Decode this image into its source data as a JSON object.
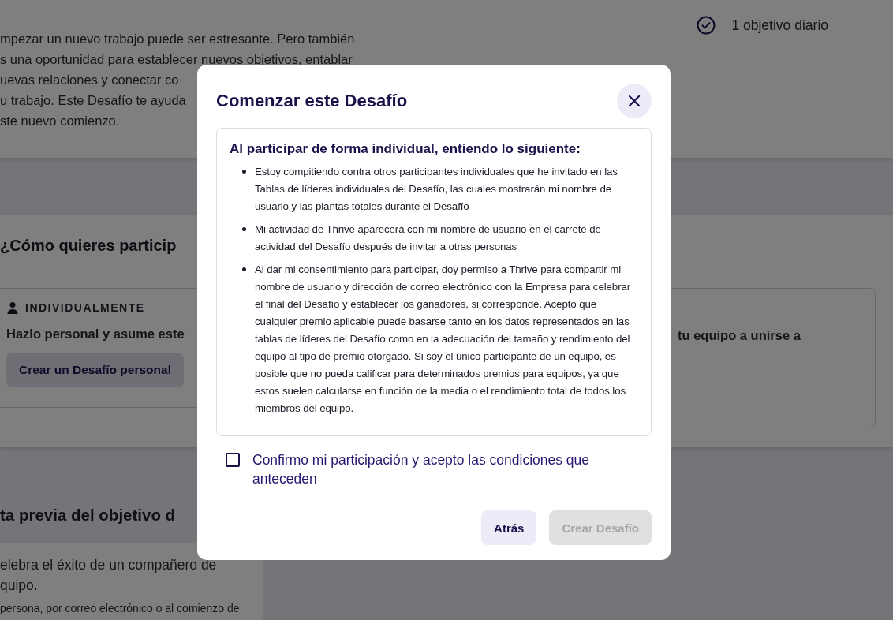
{
  "page": {
    "intro_lines": [
      "mpezar un nuevo trabajo puede ser estresante. Pero también",
      "s una oportunidad para establecer nuevos objetivos, entablar",
      "uevas relaciones y conectar co",
      "u trabajo. Este Desafío te ayuda",
      "ste nuevo comienzo."
    ],
    "daily_goal": {
      "label": "1 objetivo diario"
    },
    "participation": {
      "heading": "¿Cómo quieres particip",
      "individual": {
        "label": "INDIVIDUALMENTE",
        "description": "Hazlo personal y asume este",
        "button": "Crear un Desafío personal"
      },
      "team": {
        "description": "tu equipo a unirse a"
      }
    },
    "preview": {
      "heading": "ta previa del objetivo d",
      "lines": [
        "elebra el éxito de un compañero de",
        "quipo."
      ],
      "note": "persona, por correo electrónico o al comienzo de"
    }
  },
  "dialog": {
    "title": "Comenzar este Desafío",
    "terms": {
      "heading": "Al participar de forma individual, entiendo lo siguiente:",
      "items": [
        "Estoy compitiendo contra otros participantes individuales que he invitado en las Tablas de líderes individuales del Desafío, las cuales mostrarán mi nombre de usuario y las plantas totales durante el Desafío",
        "Mi actividad de Thrive aparecerá con mi nombre de usuario en el carrete de actividad del Desafío después de invitar a otras personas",
        "Al dar mi consentimiento para participar, doy permiso a Thrive para compartir mi nombre de usuario y dirección de correo electrónico con la Empresa para celebrar el final del Desafío y establecer los ganadores, si corresponde. Acepto que cualquier premio aplicable puede basarse tanto en los datos representados en las tablas de líderes del Desafío como en la adecuación del tamaño y rendimiento del equipo al tipo de premio otorgado. Si soy el único participante de un equipo, es posible que no pueda calificar para determinados premios para equipos, ya que estos suelen calcularse en función de la media o el rendimiento total de todos los miembros del equipo."
      ]
    },
    "consent": {
      "label": "Confirmo mi participación y acepto las condiciones que anteceden",
      "checked": false
    },
    "buttons": [
      {
        "label": "Atrás",
        "disabled": false
      },
      {
        "label": "Crear Desafío",
        "disabled": true
      }
    ]
  }
}
